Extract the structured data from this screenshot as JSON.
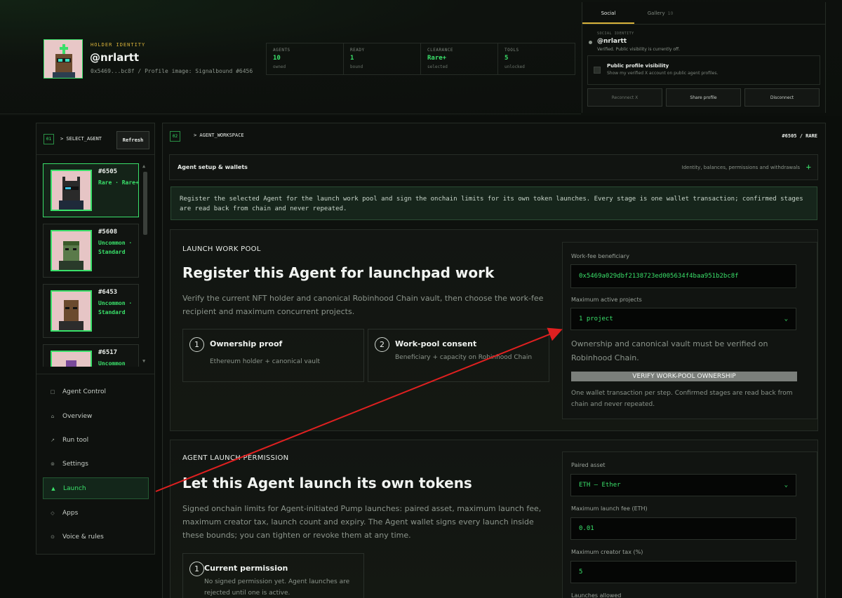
{
  "header": {
    "holder_label": "HOLDER IDENTITY",
    "handle": "@nrlartt",
    "address_line": "0x5469...bc8f / Profile image: Signalbound #6456",
    "stats": [
      {
        "label": "AGENTS",
        "value": "10",
        "sub": "owned"
      },
      {
        "label": "READY",
        "value": "1",
        "sub": "bound"
      },
      {
        "label": "CLEARANCE",
        "value": "Rare+",
        "sub": "selected"
      },
      {
        "label": "TOOLS",
        "value": "5",
        "sub": "unlocked"
      }
    ]
  },
  "social": {
    "tabs": [
      {
        "label": "Social",
        "count": ""
      },
      {
        "label": "Gallery",
        "count": "10"
      }
    ],
    "identity_label": "SOCIAL IDENTITY",
    "identity_handle": "@nrlartt",
    "identity_note": "Verified. Public visibility is currently off.",
    "visibility_title": "Public profile visibility",
    "visibility_sub": "Show my verified X account on public agent profiles.",
    "buttons": {
      "reconnect": "Reconnect X",
      "share": "Share profile",
      "disconnect": "Disconnect"
    }
  },
  "sidebar": {
    "num": "01",
    "title": "> SELECT_AGENT",
    "refresh": "Refresh",
    "agents": [
      {
        "id": "#6505",
        "tier": "Rare · Rare+"
      },
      {
        "id": "#5608",
        "tier": "Uncommon · Standard"
      },
      {
        "id": "#6453",
        "tier": "Uncommon · Standard"
      },
      {
        "id": "#6517",
        "tier": "Uncommon"
      }
    ],
    "nav": [
      {
        "icon": "□",
        "label": "Agent Control"
      },
      {
        "icon": "⌂",
        "label": "Overview"
      },
      {
        "icon": "↗",
        "label": "Run tool"
      },
      {
        "icon": "⊚",
        "label": "Settings"
      },
      {
        "icon": "▲",
        "label": "Launch"
      },
      {
        "icon": "◇",
        "label": "Apps"
      },
      {
        "icon": "⊙",
        "label": "Voice & rules"
      }
    ]
  },
  "workspace": {
    "num": "02",
    "title": "> AGENT_WORKSPACE",
    "tag": "#6505 / RARE",
    "setup_title": "Agent setup & wallets",
    "setup_desc": "Identity, balances, permissions and withdrawals",
    "info": "Register the selected Agent for the launch work pool and sign the onchain limits for its own token launches. Every stage is one wallet transaction; confirmed stages are read back from chain and never repeated.",
    "pool": {
      "eyebrow": "LAUNCH WORK POOL",
      "heading": "Register this Agent for launchpad work",
      "desc": "Verify the current NFT holder and canonical Robinhood Chain vault, then choose the work-fee recipient and maximum concurrent projects.",
      "steps": [
        {
          "num": "1",
          "title": "Ownership proof",
          "desc": "Ethereum holder + canonical vault"
        },
        {
          "num": "2",
          "title": "Work-pool consent",
          "desc": "Beneficiary + capacity on Robinhood Chain"
        }
      ],
      "form": {
        "beneficiary_label": "Work-fee beneficiary",
        "beneficiary_value": "0x5469a029dbf2138723ed005634f4baa951b2bc8f",
        "projects_label": "Maximum active projects",
        "projects_value": "1 project",
        "note": "Ownership and canonical vault must be verified on Robinhood Chain.",
        "verify_btn": "VERIFY WORK-POOL OWNERSHIP",
        "footnote": "One wallet transaction per step. Confirmed stages are read back from chain and never repeated."
      }
    },
    "permission": {
      "eyebrow": "AGENT LAUNCH PERMISSION",
      "heading": "Let this Agent launch its own tokens",
      "desc": "Signed onchain limits for Agent-initiated Pump launches: paired asset, maximum launch fee, maximum creator tax, launch count and expiry. The Agent wallet signs every launch inside these bounds; you can tighten or revoke them at any time.",
      "step": {
        "num": "1",
        "title": "Current permission",
        "desc": "No signed permission yet. Agent launches are rejected until one is active."
      },
      "form": {
        "asset_label": "Paired asset",
        "asset_value": "ETH — Ether",
        "fee_label": "Maximum launch fee (ETH)",
        "fee_value": "0.01",
        "tax_label": "Maximum creator tax (%)",
        "tax_value": "5",
        "launches_label": "Launches allowed"
      }
    }
  },
  "colors": {
    "accent": "#3ae06a",
    "gold": "#d8b23a",
    "annotation": "#e02020"
  }
}
